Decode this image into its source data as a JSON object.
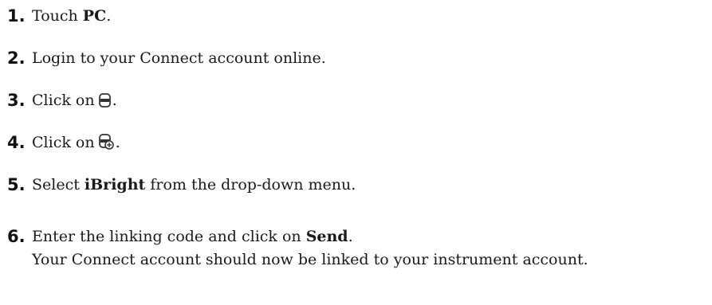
{
  "steps": [
    {
      "number": "1.",
      "parts": [
        "Touch ",
        "PC",
        "."
      ]
    },
    {
      "number": "2.",
      "text": "Login to your Connect account online."
    },
    {
      "number": "3.",
      "before": "Click on",
      "icon": "device-icon",
      "after": "."
    },
    {
      "number": "4.",
      "before": "Click on",
      "icon": "add-device-icon",
      "after": "."
    },
    {
      "number": "5.",
      "parts": [
        "Select ",
        "iBright",
        " from the drop-down menu."
      ]
    },
    {
      "number": "6.",
      "parts": [
        "Enter the linking code and click on ",
        "Send",
        "."
      ],
      "note": "Your Connect account should now be linked to your instrument account."
    }
  ]
}
